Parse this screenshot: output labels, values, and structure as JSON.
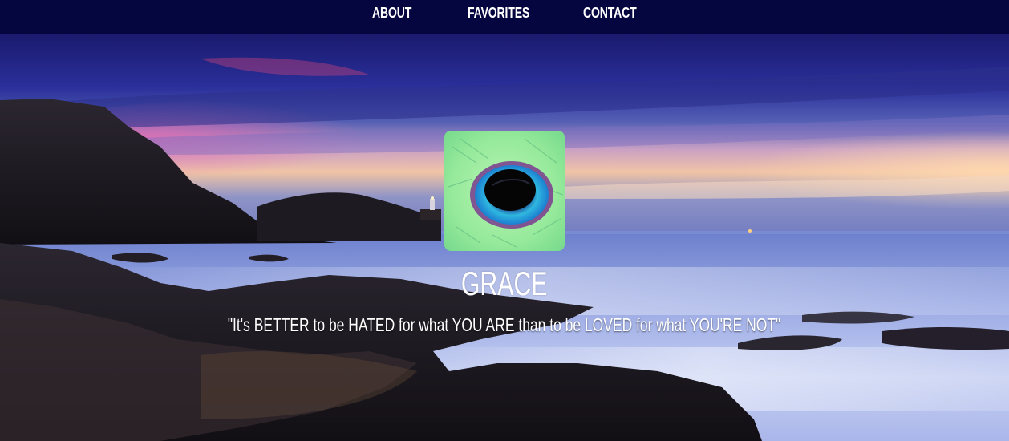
{
  "nav": {
    "items": [
      {
        "label": "ABOUT"
      },
      {
        "label": "FAVORITES"
      },
      {
        "label": "CONTACT"
      }
    ]
  },
  "profile": {
    "name": "GRACE",
    "quote": "\"It's BETTER to be HATED for what YOU ARE than to be LOVED for what YOU'RE NOT\"",
    "avatar_icon": "eye-icon"
  },
  "colors": {
    "navbar_bg": "#05053f",
    "nav_text": "#ffffff",
    "hero_text": "#ffffff"
  }
}
